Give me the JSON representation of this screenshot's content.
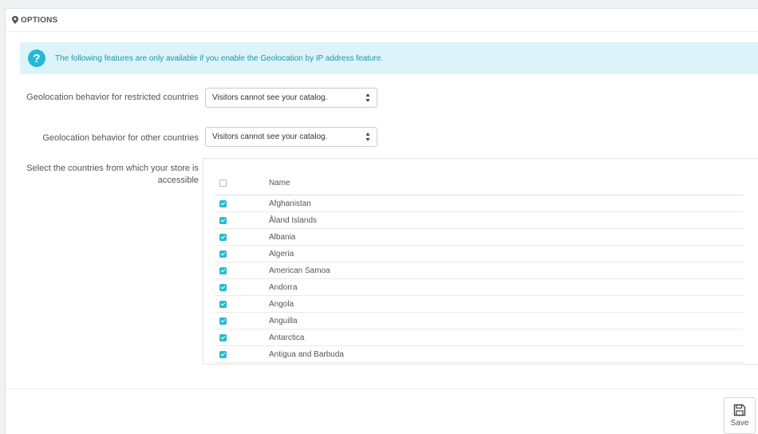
{
  "panel": {
    "title": "OPTIONS"
  },
  "alert": {
    "icon_symbol": "?",
    "text": "The following features are only available if you enable the Geolocation by IP address feature."
  },
  "form": {
    "restricted_label": "Geolocation behavior for restricted countries",
    "restricted_value": "Visitors cannot see your catalog.",
    "other_label": "Geolocation behavior for other countries",
    "other_value": "Visitors cannot see your catalog.",
    "countries_label": "Select the countries from which your store is accessible"
  },
  "countries": {
    "header_name": "Name",
    "header_checked": false,
    "rows": [
      {
        "name": "Afghanistan",
        "checked": true
      },
      {
        "name": "Åland Islands",
        "checked": true
      },
      {
        "name": "Albania",
        "checked": true
      },
      {
        "name": "Algeria",
        "checked": true
      },
      {
        "name": "American Samoa",
        "checked": true
      },
      {
        "name": "Andorra",
        "checked": true
      },
      {
        "name": "Angola",
        "checked": true
      },
      {
        "name": "Anguilla",
        "checked": true
      },
      {
        "name": "Antarctica",
        "checked": true
      },
      {
        "name": "Antigua and Barbuda",
        "checked": true
      }
    ]
  },
  "footer": {
    "save_label": "Save"
  },
  "colors": {
    "accent": "#25b9d7",
    "alert_bg": "#dcf4f9",
    "alert_text": "#1e94ab"
  },
  "icons": {
    "heading": "map-pin-icon",
    "alert": "question-circle-icon",
    "save": "floppy-disk-icon"
  }
}
